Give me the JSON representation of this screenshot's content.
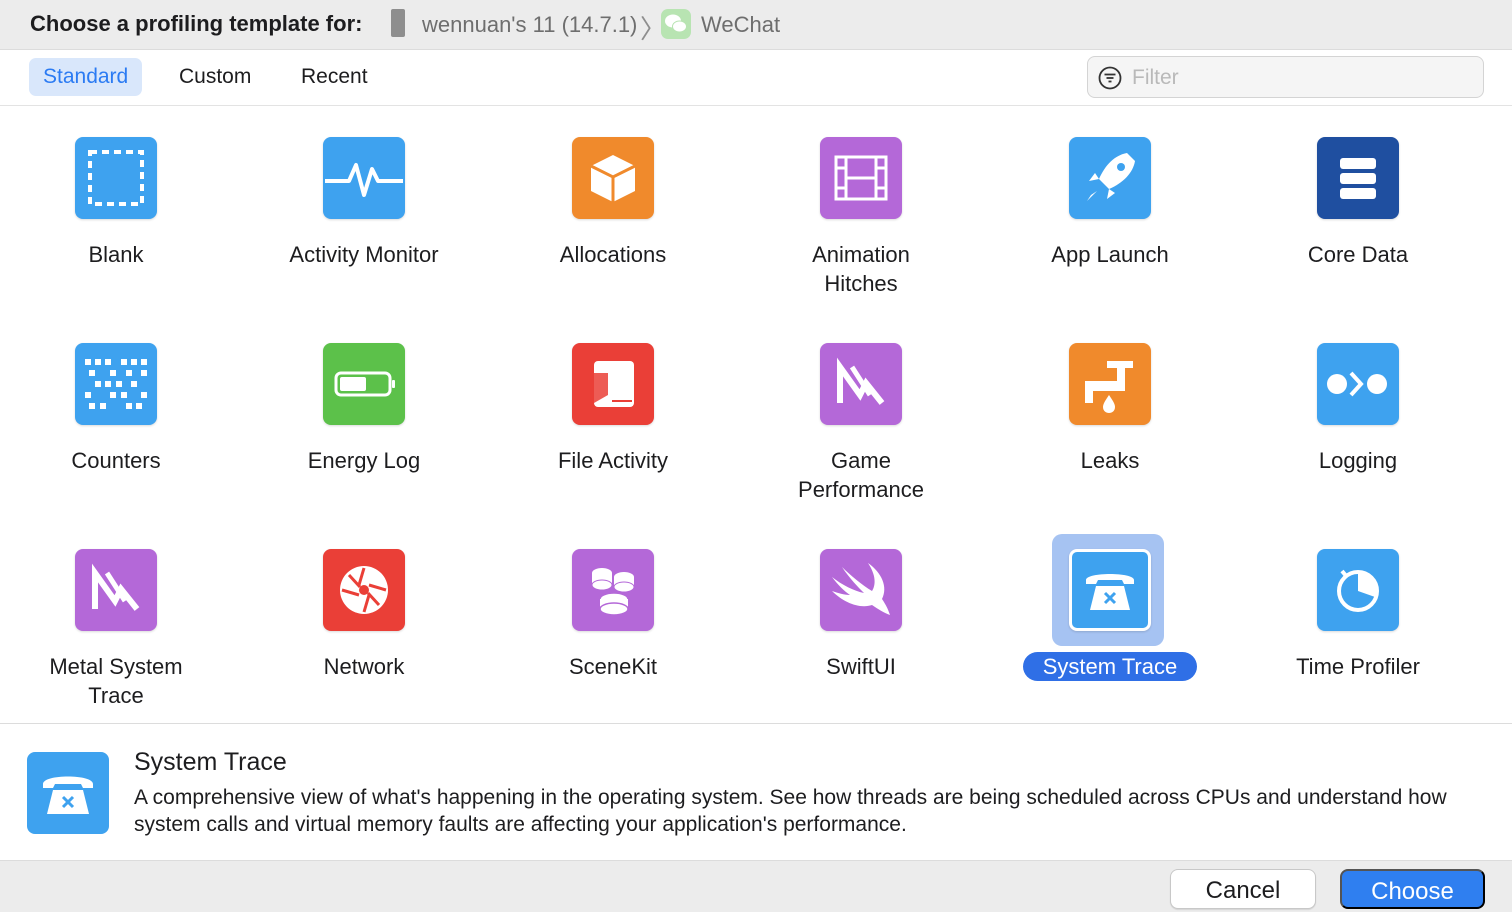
{
  "header": {
    "title": "Choose a profiling template for:",
    "device": "wennuan's 11 (14.7.1)",
    "app": "WeChat"
  },
  "tabs": [
    {
      "label": "Standard",
      "active": true
    },
    {
      "label": "Custom",
      "active": false
    },
    {
      "label": "Recent",
      "active": false
    }
  ],
  "filter": {
    "placeholder": "Filter",
    "value": ""
  },
  "templates": [
    {
      "name": "Blank",
      "icon": "blank-icon",
      "color": "#3ea2ef"
    },
    {
      "name": "Activity Monitor",
      "icon": "activity-monitor-icon",
      "color": "#3ea2ef"
    },
    {
      "name": "Allocations",
      "icon": "allocations-icon",
      "color": "#f08a2c"
    },
    {
      "name": "Animation\nHitches",
      "icon": "animation-hitches-icon",
      "color": "#b468d8"
    },
    {
      "name": "App Launch",
      "icon": "app-launch-icon",
      "color": "#3ea2ef"
    },
    {
      "name": "Core Data",
      "icon": "core-data-icon",
      "color": "#1f4fa0"
    },
    {
      "name": "Counters",
      "icon": "counters-icon",
      "color": "#3ea2ef"
    },
    {
      "name": "Energy Log",
      "icon": "energy-log-icon",
      "color": "#5cc14a"
    },
    {
      "name": "File Activity",
      "icon": "file-activity-icon",
      "color": "#ea3f37"
    },
    {
      "name": "Game\nPerformance",
      "icon": "game-performance-icon",
      "color": "#b468d8"
    },
    {
      "name": "Leaks",
      "icon": "leaks-icon",
      "color": "#f08a2c"
    },
    {
      "name": "Logging",
      "icon": "logging-icon",
      "color": "#3ea2ef"
    },
    {
      "name": "Metal System\nTrace",
      "icon": "metal-system-trace-icon",
      "color": "#b468d8"
    },
    {
      "name": "Network",
      "icon": "network-icon",
      "color": "#ea3f37"
    },
    {
      "name": "SceneKit",
      "icon": "scenekit-icon",
      "color": "#b468d8"
    },
    {
      "name": "SwiftUI",
      "icon": "swiftui-icon",
      "color": "#b468d8"
    },
    {
      "name": "System Trace",
      "icon": "system-trace-icon",
      "color": "#3ea2ef",
      "selected": true
    },
    {
      "name": "Time Profiler",
      "icon": "time-profiler-icon",
      "color": "#3ea2ef"
    }
  ],
  "description": {
    "title": "System Trace",
    "text": "A comprehensive view of what's happening in the operating system.  See how threads are being scheduled across CPUs and understand how system calls and virtual memory faults are affecting your application's performance."
  },
  "footer": {
    "cancel_label": "Cancel",
    "choose_label": "Choose"
  }
}
